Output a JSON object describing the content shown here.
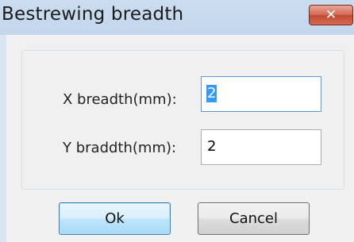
{
  "window": {
    "title": "Bestrewing breadth",
    "close_glyph": "✕"
  },
  "fields": {
    "x": {
      "label": "X breadth(mm):",
      "value": "2"
    },
    "y": {
      "label": "Y braddth(mm):",
      "value": "2"
    }
  },
  "buttons": {
    "ok_label": "Ok",
    "cancel_label": "Cancel"
  },
  "colors": {
    "titlebar": "#c8daee",
    "close_button": "#c94c35",
    "selection": "#3399ff"
  }
}
